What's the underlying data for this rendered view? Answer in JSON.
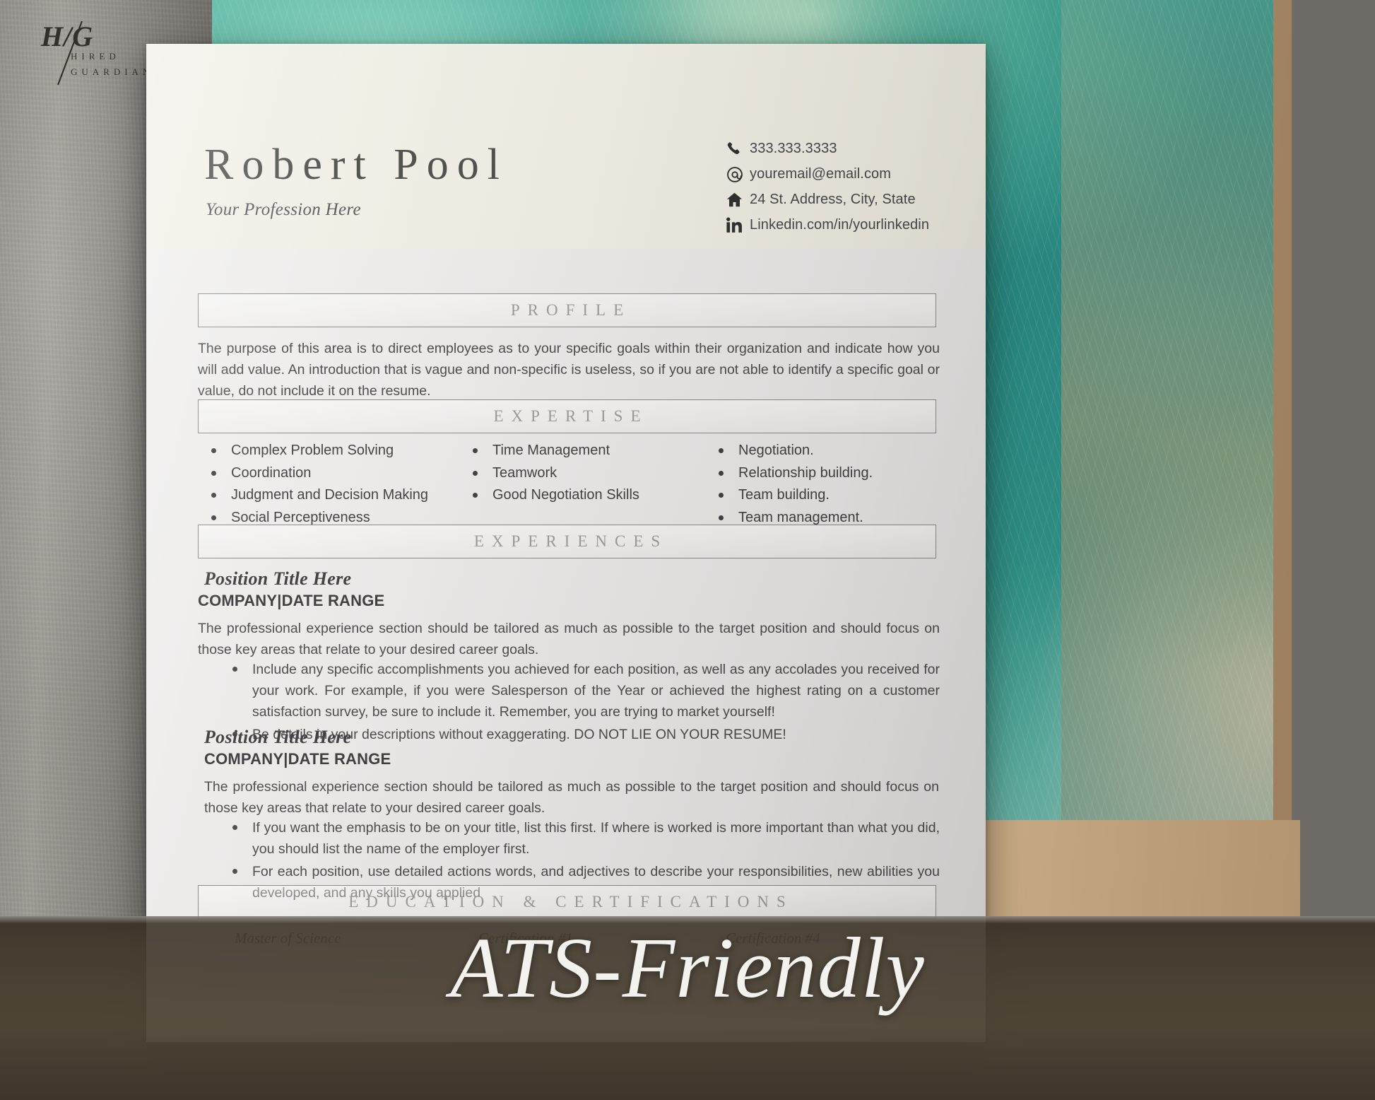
{
  "brand": {
    "mark": "H/G",
    "line1": "HIRED",
    "line2": "GUARDIAN"
  },
  "overlay": {
    "badge_text": "ATS-Friendly"
  },
  "resume": {
    "name": "Robert Pool",
    "profession": "Your Profession Here",
    "contact": [
      {
        "icon": "phone-icon",
        "value": "333.333.3333"
      },
      {
        "icon": "email-icon",
        "value": "youremail@email.com"
      },
      {
        "icon": "home-icon",
        "value": "24 St. Address, City, State"
      },
      {
        "icon": "linkedin-icon",
        "value": "Linkedin.com/in/yourlinkedin"
      }
    ],
    "sections": {
      "profile": {
        "heading": "PROFILE",
        "body": "The purpose of this area is to direct employees as to your specific goals within their organization and indicate how you will add value. An introduction that is vague and non-specific is useless, so if you are not able to identify a specific goal or value, do not include it on the resume."
      },
      "expertise": {
        "heading": "EXPERTISE",
        "column1": [
          "Complex Problem Solving",
          "Coordination",
          "Judgment and Decision Making",
          "Social Perceptiveness"
        ],
        "column2": [
          "Time Management",
          "Teamwork",
          "Good Negotiation Skills"
        ],
        "column3": [
          "Negotiation.",
          "Relationship building.",
          "Team building.",
          "Team management."
        ]
      },
      "experiences": {
        "heading": "EXPERIENCES",
        "entries": [
          {
            "title": "Position Title Here",
            "company": "COMPANY|DATE RANGE",
            "summary": "The professional experience section should be tailored as much as possible to the target position and should focus on those key areas that relate to your desired career goals.",
            "bullets": [
              "Include any specific accomplishments you achieved for each position, as well as any accolades you received for your work.  For example, if you were Salesperson of the Year or achieved the highest rating on a customer satisfaction survey, be sure to include it.  Remember, you are trying to market yourself!",
              "Be details in your descriptions without exaggerating.  DO NOT LIE ON YOUR RESUME!"
            ]
          },
          {
            "title": "Position Title Here",
            "company": "COMPANY|DATE RANGE",
            "summary": "The professional experience section should be tailored as much as possible to the target position and should focus on those key areas that relate to your desired career goals.",
            "bullets": [
              "If you want the emphasis to be on your title, list this first.  If where is worked is more important than what you did, you should list the name of the employer first.",
              "For each position, use detailed actions words, and adjectives to describe your responsibilities, new abilities you developed, and any skills you applied"
            ]
          }
        ]
      },
      "education": {
        "heading": "EDUCATION & CERTIFICATIONS",
        "items": [
          "Master of Science",
          "Certification #1",
          "Certification #4"
        ]
      }
    }
  },
  "colors": {
    "sheet": "#ececea",
    "header_band": "#f1eee6",
    "section_heading": "#9b9b99",
    "text": "#4a4a4c",
    "overlay": "#4e4436"
  }
}
